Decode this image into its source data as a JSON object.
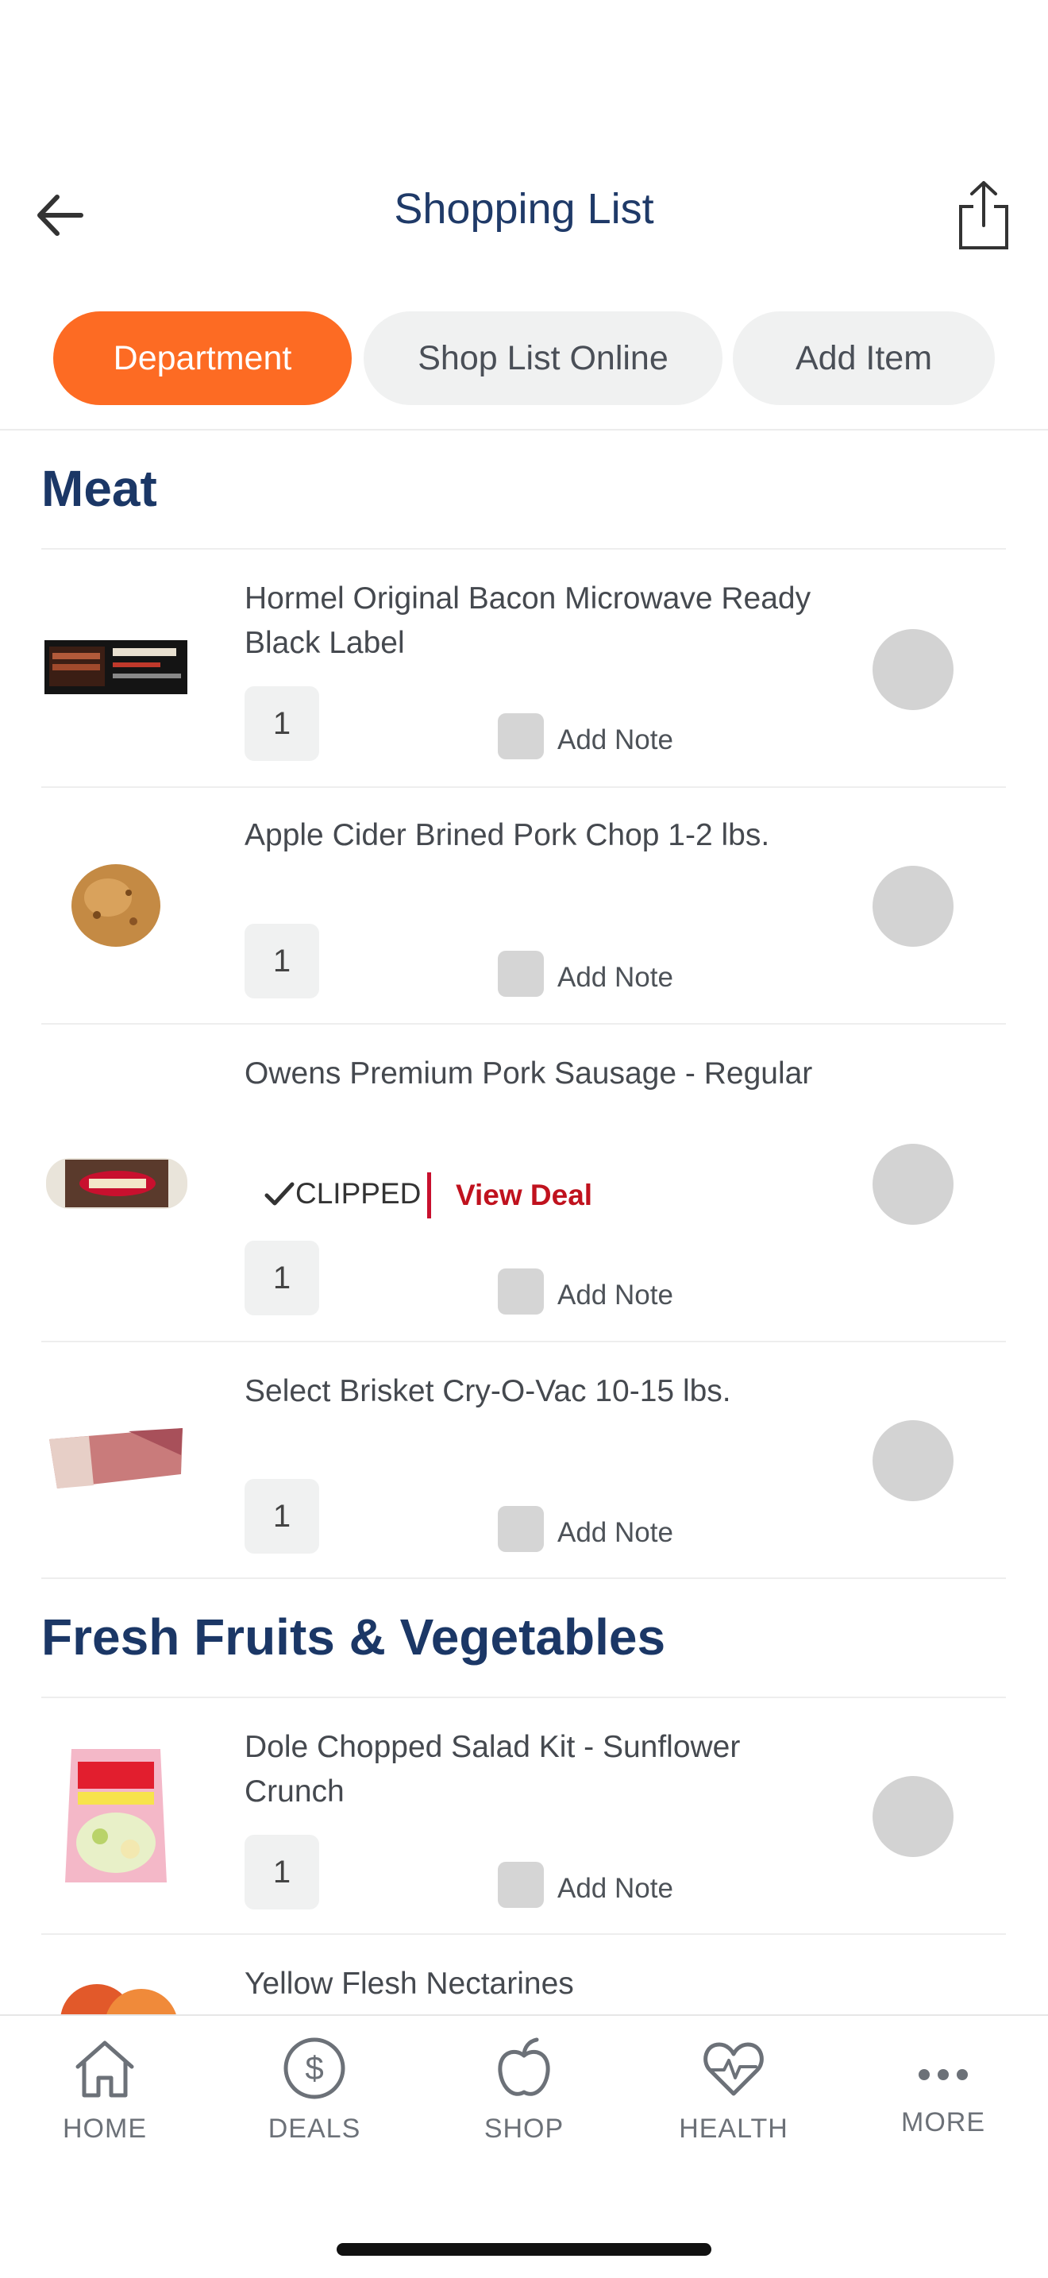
{
  "header": {
    "title": "Shopping List",
    "back_icon": "arrow-left-icon",
    "share_icon": "share-icon"
  },
  "tabs": [
    {
      "label": "Department",
      "active": true
    },
    {
      "label": "Shop List Online",
      "active": false
    },
    {
      "label": "Add Item",
      "active": false
    }
  ],
  "sections": [
    {
      "title": "Meat",
      "items": [
        {
          "name": "Hormel Original Bacon Microwave Ready Black Label",
          "qty": "1",
          "note_label": "Add Note"
        },
        {
          "name": "Apple Cider Brined Pork Chop 1-2 lbs.",
          "qty": "1",
          "note_label": "Add Note"
        },
        {
          "name": "Owens Premium Pork Sausage - Regular",
          "qty": "1",
          "note_label": "Add Note",
          "clipped_label": "CLIPPED",
          "deal_label": "View Deal"
        },
        {
          "name": "Select Brisket Cry-O-Vac 10-15 lbs.",
          "qty": "1",
          "note_label": "Add Note"
        }
      ]
    },
    {
      "title": "Fresh Fruits & Vegetables",
      "items": [
        {
          "name": "Dole Chopped Salad Kit - Sunflower Crunch",
          "qty": "1",
          "note_label": "Add Note"
        },
        {
          "name": "Yellow Flesh Nectarines"
        }
      ]
    }
  ],
  "nav": [
    {
      "label": "HOME",
      "icon": "home-icon"
    },
    {
      "label": "DEALS",
      "icon": "dollar-icon"
    },
    {
      "label": "SHOP",
      "icon": "apple-icon"
    },
    {
      "label": "HEALTH",
      "icon": "heart-pulse-icon"
    },
    {
      "label": "MORE",
      "icon": "more-icon"
    }
  ],
  "colors": {
    "accent": "#fd6b23",
    "title": "#1f3a68",
    "deal": "#c0121e"
  }
}
